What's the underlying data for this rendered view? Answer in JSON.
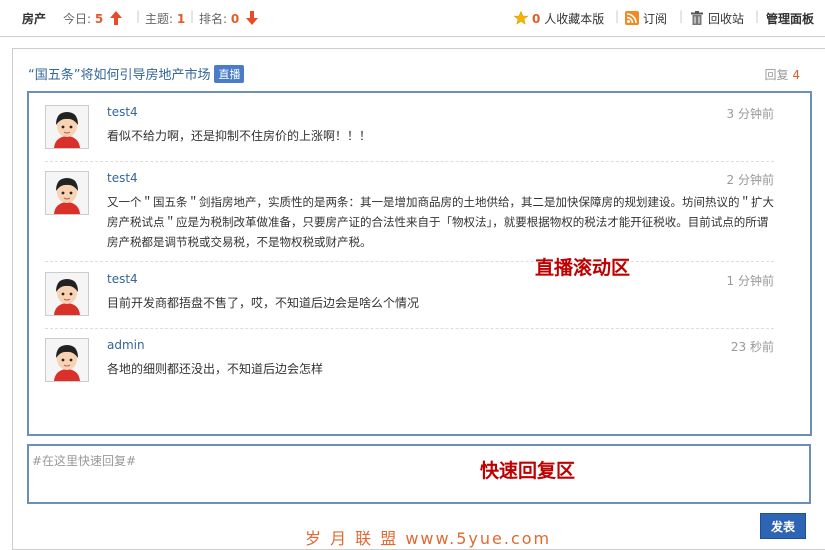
{
  "header": {
    "forum_name": "房产",
    "today_label": "今日:",
    "today_count": "5",
    "topics_label": "主题:",
    "topics_count": "1",
    "rank_label": "排名:",
    "rank_count": "0",
    "favorites_count": "0",
    "favorites_label": "人收藏本版",
    "subscribe_label": "订阅",
    "recycle_label": "回收站",
    "manage_label": "管理面板"
  },
  "thread": {
    "title": "“国五条”将如何引导房地产市场",
    "badge": "直播",
    "reply_label": "回复",
    "reply_count": "4"
  },
  "posts": [
    {
      "user": "test4",
      "time": "3 分钟前",
      "message": "看似不给力啊，还是抑制不住房价的上涨啊！！！"
    },
    {
      "user": "test4",
      "time": "2 分钟前",
      "message": "又一个＂国五条＂剑指房地产，实质性的是两条：其一是增加商品房的土地供给，其二是加快保障房的规划建设。坊间热议的＂扩大房产税试点＂应是为税制改革做准备，只要房产证的合法性来自于「物权法」，就要根据物权的税法才能开征税收。目前试点的所谓房产税都是调节税或交易税，不是物权税或财产税。"
    },
    {
      "user": "test4",
      "time": "1 分钟前",
      "message": "目前开发商都捂盘不售了，哎，不知道后边会是啥么个情况"
    },
    {
      "user": "admin",
      "time": "23 秒前",
      "message": "各地的细则都还没出，不知道后边会怎样"
    }
  ],
  "annotations": {
    "live_area": "直播滚动区",
    "reply_area": "快速回复区"
  },
  "reply": {
    "placeholder": "#在这里快速回复#",
    "submit_label": "发表"
  },
  "footer": {
    "site_text": "岁 月 联 盟  www.5yue.com"
  },
  "colors": {
    "accent_number": "#e25b2a",
    "link": "#336699",
    "box_border": "#6b8fb5",
    "button": "#2d64b4",
    "annotation": "#c00000"
  }
}
